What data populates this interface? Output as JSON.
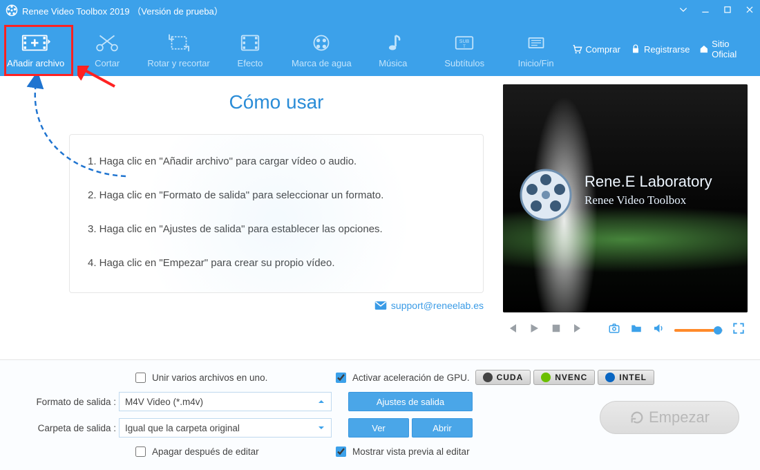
{
  "titlebar": {
    "title": "Renee Video Toolbox 2019 （Versión de prueba）"
  },
  "toolbar": [
    {
      "id": "add",
      "label": "Añadir archivo",
      "active": true
    },
    {
      "id": "cut",
      "label": "Cortar"
    },
    {
      "id": "rotate",
      "label": "Rotar y recortar"
    },
    {
      "id": "effect",
      "label": "Efecto"
    },
    {
      "id": "watermark",
      "label": "Marca de agua"
    },
    {
      "id": "music",
      "label": "Música"
    },
    {
      "id": "subtitles",
      "label": "Subtítulos"
    },
    {
      "id": "startend",
      "label": "Inicio/Fin"
    }
  ],
  "rightlinks": {
    "buy": "Comprar",
    "register": "Registrarse",
    "official": "Sitio Oficial"
  },
  "howto": {
    "title": "Cómo usar",
    "steps": [
      "1. Haga clic en \"Añadir archivo\" para cargar vídeo o audio.",
      "2. Haga clic en \"Formato de salida\" para seleccionar un formato.",
      "3. Haga clic en \"Ajustes de salida\" para establecer las opciones.",
      "4. Haga clic en \"Empezar\" para crear su propio vídeo."
    ],
    "support": "support@reneelab.es"
  },
  "preview_brand": {
    "line1": "Rene.E Laboratory",
    "line2": "Renee Video Toolbox"
  },
  "bottom": {
    "merge_label": "Unir varios archivos en uno.",
    "merge_checked": false,
    "gpu_label": "Activar aceleración de GPU.",
    "gpu_checked": true,
    "gpu_badges": [
      "CUDA",
      "NVENC",
      "INTEL"
    ],
    "out_format_label": "Formato de salida :",
    "out_format_value": "M4V Video (*.m4v)",
    "out_settings_btn": "Ajustes de salida",
    "out_folder_label": "Carpeta de salida :",
    "out_folder_value": "Igual que la carpeta original",
    "view_btn": "Ver",
    "open_btn": "Abrir",
    "shutdown_label": "Apagar después de editar",
    "shutdown_checked": false,
    "preview_label": "Mostrar vista previa al editar",
    "preview_checked": true,
    "start_btn": "Empezar"
  }
}
